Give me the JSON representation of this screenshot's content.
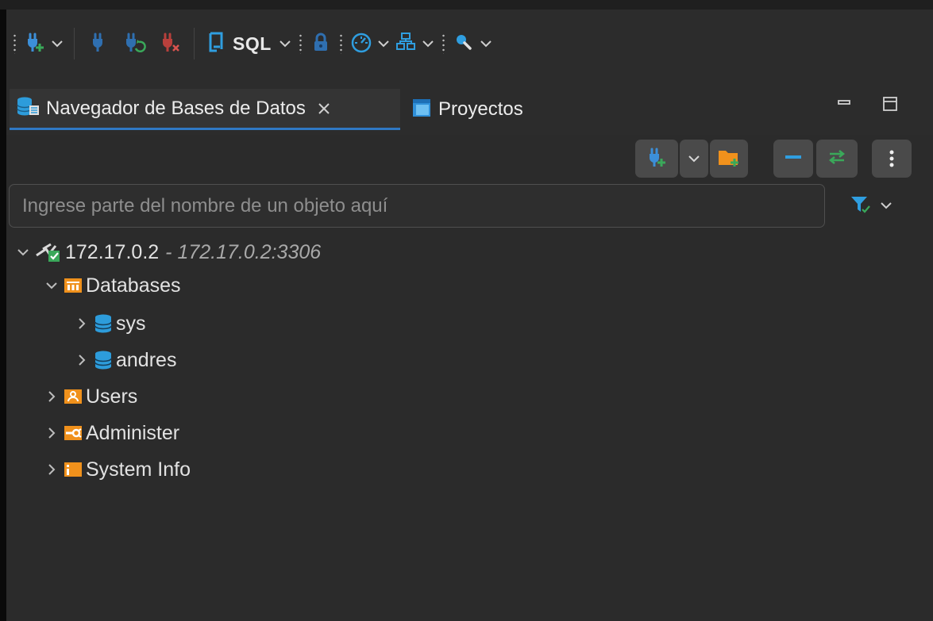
{
  "toolbar": {
    "sql_label": "SQL",
    "icons": [
      "new-connection-icon",
      "connect-icon",
      "invalidate-reconnect-icon",
      "disconnect-icon",
      "sql-editor-icon",
      "lock-transaction-icon",
      "dashboard-icon",
      "database-tasks-icon",
      "search-icon"
    ]
  },
  "tabs": {
    "navigator": {
      "label": "Navegador de Bases de Datos"
    },
    "projects": {
      "label": "Proyectos"
    }
  },
  "search": {
    "placeholder": "Ingrese parte del nombre de un objeto aquí",
    "value": ""
  },
  "tree": {
    "connection": {
      "label": "172.17.0.2",
      "detail": "- 172.17.0.2:3306"
    },
    "databases": {
      "label": "Databases"
    },
    "db_sys": {
      "label": "sys"
    },
    "db_andres": {
      "label": "andres"
    },
    "users": {
      "label": "Users"
    },
    "administer": {
      "label": "Administer"
    },
    "system_info": {
      "label": "System Info"
    }
  },
  "colors": {
    "accent_blue": "#2f78c4",
    "folder_orange": "#f0911c",
    "db_blue": "#2d9cdb",
    "plug_blue": "#3c8fd8",
    "green": "#3aa85a",
    "red": "#d9534f"
  }
}
